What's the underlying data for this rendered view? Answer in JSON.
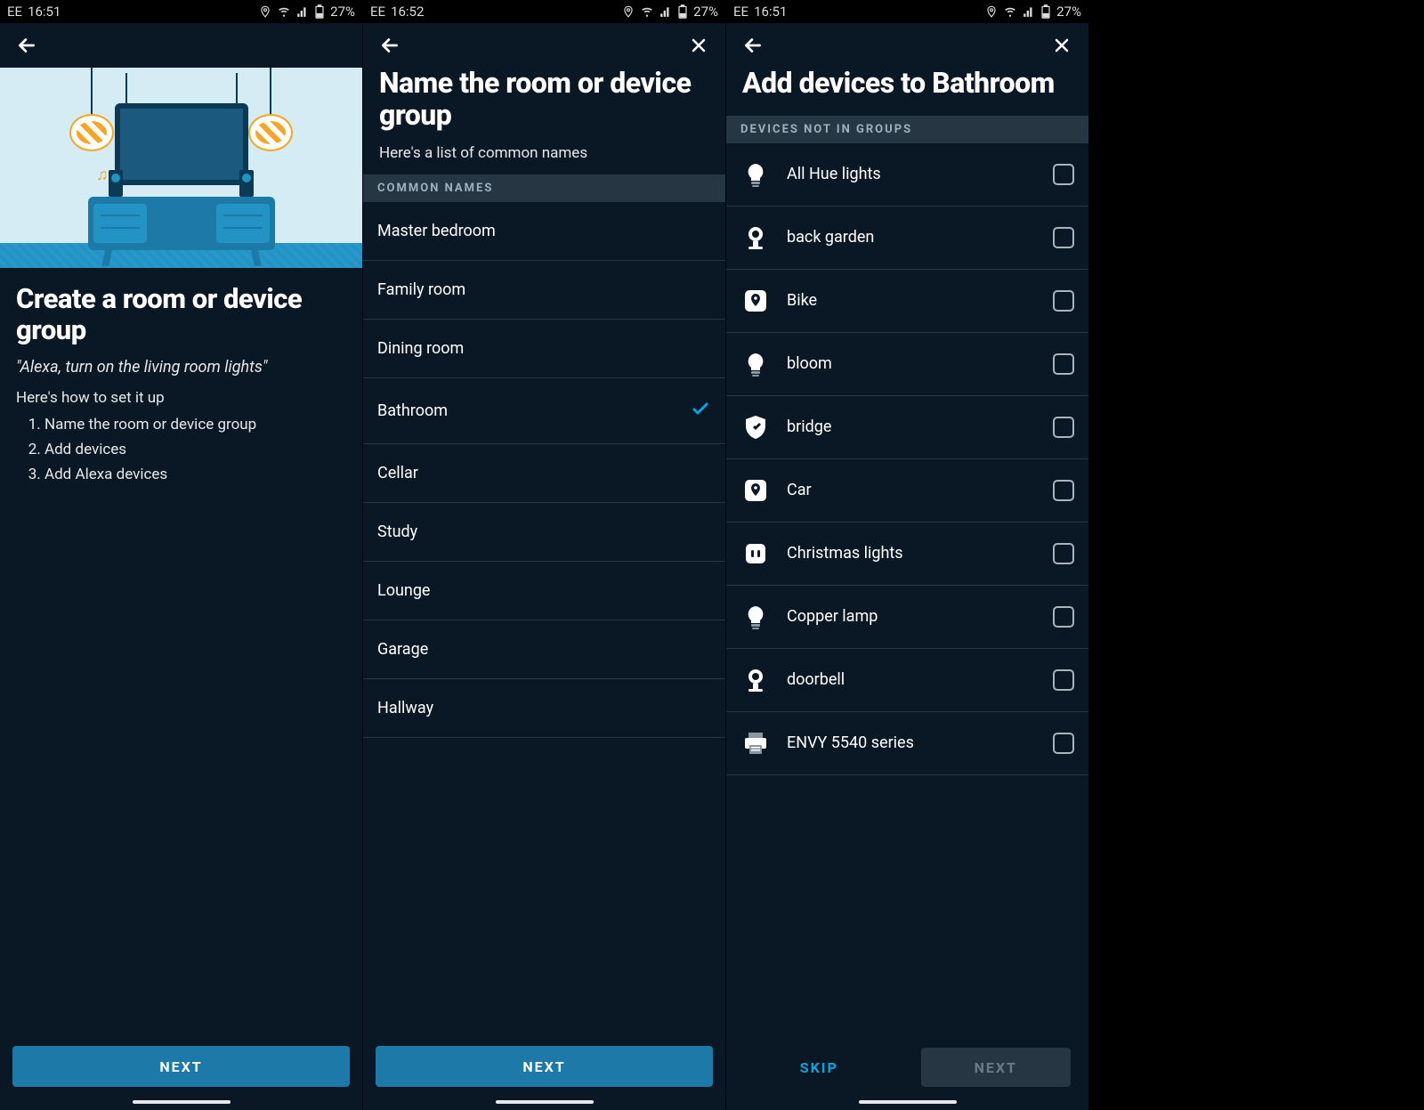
{
  "statusbar": {
    "carrier": "EE",
    "time_a": "16:51",
    "time_b": "16:52",
    "battery": "27%"
  },
  "screen1": {
    "title": "Create a room or device group",
    "quote": "\"Alexa, turn on the living room lights\"",
    "howto": "Here's how to set it up",
    "steps": [
      "Name the room or device group",
      "Add devices",
      "Add Alexa devices"
    ],
    "next": "NEXT"
  },
  "screen2": {
    "title": "Name the room or device group",
    "subtitle": "Here's a list of common names",
    "section": "COMMON NAMES",
    "names": [
      {
        "label": "Master bedroom",
        "selected": false
      },
      {
        "label": "Family room",
        "selected": false
      },
      {
        "label": "Dining room",
        "selected": false
      },
      {
        "label": "Bathroom",
        "selected": true
      },
      {
        "label": "Cellar",
        "selected": false
      },
      {
        "label": "Study",
        "selected": false
      },
      {
        "label": "Lounge",
        "selected": false
      },
      {
        "label": "Garage",
        "selected": false
      },
      {
        "label": "Hallway",
        "selected": false
      }
    ],
    "next": "NEXT"
  },
  "screen3": {
    "title": "Add devices to Bathroom",
    "section": "DEVICES NOT IN GROUPS",
    "devices": [
      {
        "label": "All Hue lights",
        "icon": "bulb"
      },
      {
        "label": "back garden",
        "icon": "camera"
      },
      {
        "label": "Bike",
        "icon": "tile"
      },
      {
        "label": "bloom",
        "icon": "bulb"
      },
      {
        "label": "bridge",
        "icon": "shield"
      },
      {
        "label": "Car",
        "icon": "tile"
      },
      {
        "label": "Christmas lights",
        "icon": "plug"
      },
      {
        "label": "Copper lamp",
        "icon": "bulb"
      },
      {
        "label": "doorbell",
        "icon": "camera"
      },
      {
        "label": "ENVY 5540 series",
        "icon": "printer"
      }
    ],
    "skip": "SKIP",
    "next": "NEXT"
  }
}
